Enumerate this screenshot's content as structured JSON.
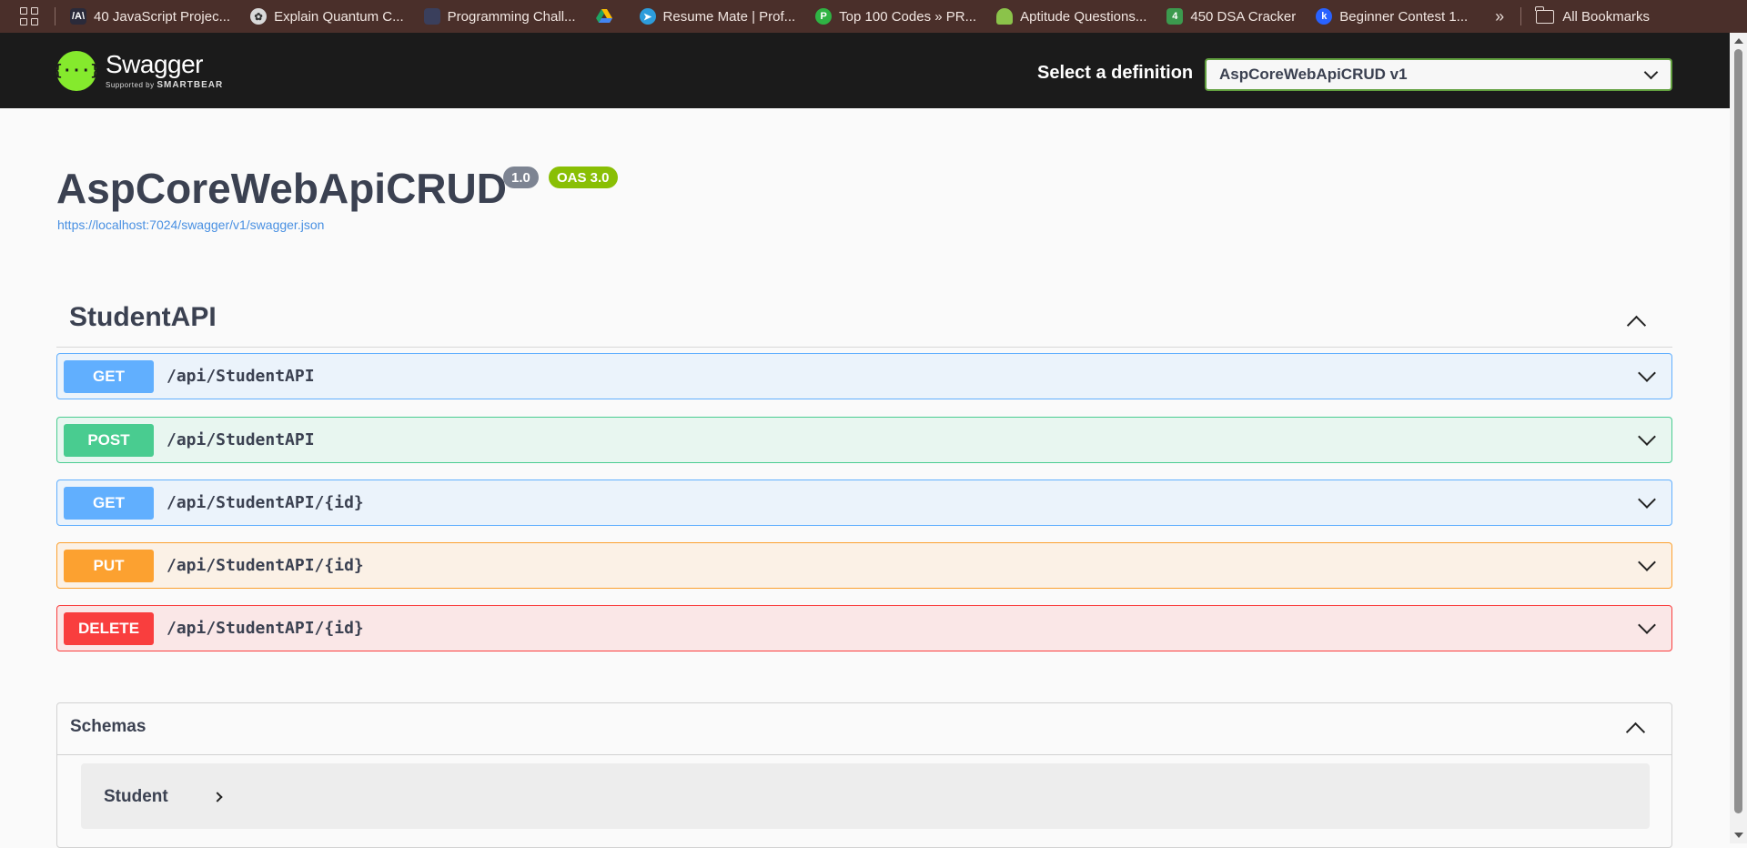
{
  "bookmarks": [
    {
      "label": "40 JavaScript Projec...",
      "icon": "code-icon",
      "color": "#2a2a3a"
    },
    {
      "label": "Explain Quantum C...",
      "icon": "chatgpt-icon",
      "color": "#cfcfcf"
    },
    {
      "label": "Programming Chall...",
      "icon": "doc-icon",
      "color": "#3a3f5c"
    },
    {
      "label": "",
      "icon": "google-drive-icon",
      "color": "#1fa463"
    },
    {
      "label": "Resume Mate | Prof...",
      "icon": "bird-icon",
      "color": "#2d9cdb"
    },
    {
      "label": "Top 100 Codes » PR...",
      "icon": "shield-icon",
      "color": "#2fb344"
    },
    {
      "label": "Aptitude Questions...",
      "icon": "mushroom-icon",
      "color": "#8bc34a"
    },
    {
      "label": "450 DSA Cracker",
      "icon": "four-icon",
      "color": "#3c9a4e"
    },
    {
      "label": "Beginner Contest 1...",
      "icon": "codechef-icon",
      "color": "#2962ff"
    }
  ],
  "bookmarks_more": "»",
  "bookmarks_folder": "All Bookmarks",
  "header": {
    "logo_name": "Swagger",
    "logo_glyph": "{···}",
    "logo_supported": "Supported by",
    "logo_company": "SMARTBEAR",
    "definition_label": "Select a definition",
    "definition_value": "AspCoreWebApiCRUD v1"
  },
  "info": {
    "title": "AspCoreWebApiCRUD",
    "version": "1.0",
    "oas": "OAS 3.0",
    "spec_url": "https://localhost:7024/swagger/v1/swagger.json"
  },
  "tag": {
    "name": "StudentAPI"
  },
  "operations": [
    {
      "method": "GET",
      "path": "/api/StudentAPI"
    },
    {
      "method": "POST",
      "path": "/api/StudentAPI"
    },
    {
      "method": "GET",
      "path": "/api/StudentAPI/{id}"
    },
    {
      "method": "PUT",
      "path": "/api/StudentAPI/{id}"
    },
    {
      "method": "DELETE",
      "path": "/api/StudentAPI/{id}"
    }
  ],
  "schemas": {
    "title": "Schemas",
    "models": [
      "Student"
    ]
  },
  "colors": {
    "get": "#61affe",
    "post": "#49cc90",
    "put": "#fca130",
    "delete": "#f93e3e",
    "topbar": "#1b1b1b",
    "logo": "#85ea2d"
  }
}
